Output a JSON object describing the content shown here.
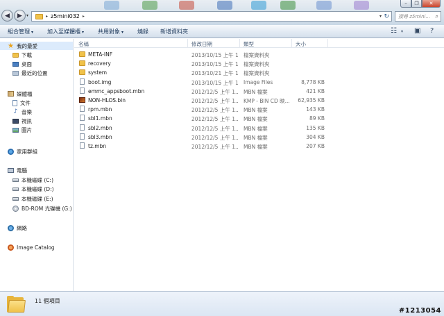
{
  "window": {
    "caption_buttons": {
      "minimize": "–",
      "maximize": "❐",
      "close": "✕"
    }
  },
  "address_bar": {
    "separator": "▸",
    "path": "z5mini032",
    "dropdown": "▾",
    "refresh": "↻"
  },
  "search": {
    "placeholder": "搜尋 z5mini..."
  },
  "toolbar": {
    "organize": "組合管理",
    "include_in_library": "加入至媒體櫃",
    "share_with": "共用對象",
    "burn": "燒錄",
    "new_folder": "新增資料夾",
    "caret": "▾"
  },
  "nav": {
    "favorites": {
      "label": "我的最愛",
      "items": [
        "下載",
        "桌面",
        "最近的位置"
      ]
    },
    "libraries": {
      "label": "媒體櫃",
      "items": [
        "文件",
        "音樂",
        "視訊",
        "圖片"
      ]
    },
    "homegroup": "家用群組",
    "computer": {
      "label": "電腦",
      "items": [
        "本機磁碟 (C:)",
        "本機磁碟 (D:)",
        "本機磁碟 (E:)",
        "BD-ROM 光碟機 (G:)"
      ]
    },
    "network": "網路",
    "image_catalog": "Image Catalog"
  },
  "columns": {
    "name": "名稱",
    "date": "修改日期",
    "type": "類型",
    "size": "大小"
  },
  "files": [
    {
      "name": "META-INF",
      "date": "2013/10/15 上午 1...",
      "type": "檔案資料夾",
      "size": "",
      "icon": "folder-icon"
    },
    {
      "name": "recovery",
      "date": "2013/10/15 上午 1...",
      "type": "檔案資料夾",
      "size": "",
      "icon": "folder-icon"
    },
    {
      "name": "system",
      "date": "2013/10/21 上午 1...",
      "type": "檔案資料夾",
      "size": "",
      "icon": "folder-icon"
    },
    {
      "name": "boot.img",
      "date": "2013/10/15 上午 1...",
      "type": "Image Files",
      "size": "8,778 KB",
      "icon": "file-icon"
    },
    {
      "name": "emmc_appsboot.mbn",
      "date": "2012/12/5 上午 1...",
      "type": "MBN 檔案",
      "size": "421 KB",
      "icon": "file-icon"
    },
    {
      "name": "NON-HLOS.bin",
      "date": "2012/12/5 上午 1...",
      "type": "KMP - BIN CD 映...",
      "size": "62,935 KB",
      "icon": "kmp-bin-icon"
    },
    {
      "name": "rpm.mbn",
      "date": "2012/12/5 上午 1...",
      "type": "MBN 檔案",
      "size": "143 KB",
      "icon": "file-icon"
    },
    {
      "name": "sbl1.mbn",
      "date": "2012/12/5 上午 1...",
      "type": "MBN 檔案",
      "size": "89 KB",
      "icon": "file-icon"
    },
    {
      "name": "sbl2.mbn",
      "date": "2012/12/5 上午 1...",
      "type": "MBN 檔案",
      "size": "135 KB",
      "icon": "file-icon"
    },
    {
      "name": "sbl3.mbn",
      "date": "2012/12/5 上午 1...",
      "type": "MBN 檔案",
      "size": "304 KB",
      "icon": "file-icon"
    },
    {
      "name": "tz.mbn",
      "date": "2012/12/5 上午 1...",
      "type": "MBN 檔案",
      "size": "207 KB",
      "icon": "file-icon"
    }
  ],
  "details": {
    "item_count": "11 個項目"
  },
  "watermark": "#1213054",
  "colors": {
    "selection": "#dcebfc",
    "folder": "#f0c24a",
    "toolbar_text": "#1e395b"
  }
}
